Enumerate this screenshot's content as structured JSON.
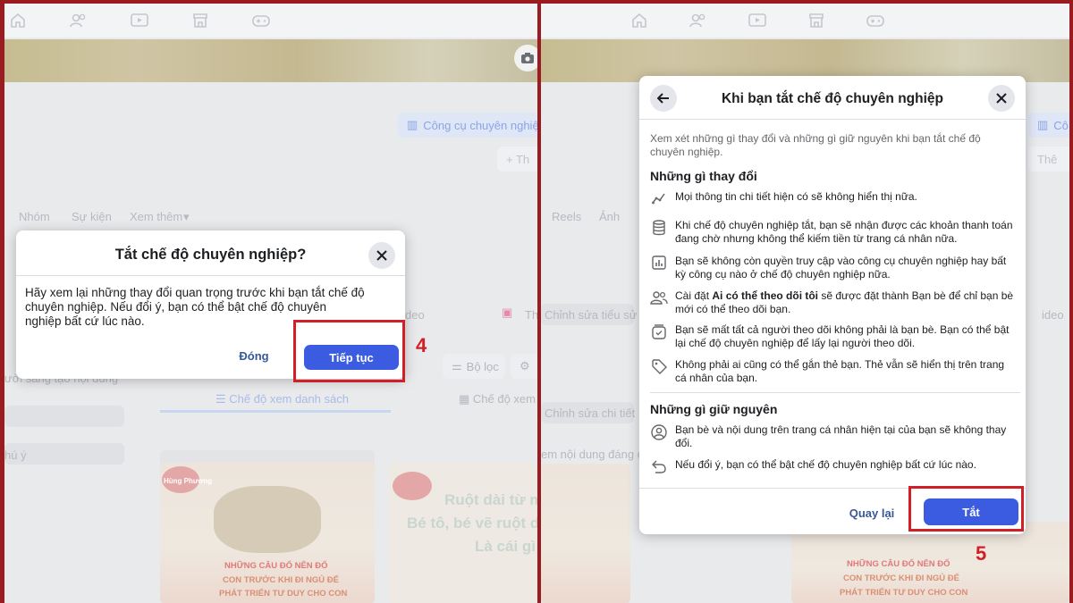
{
  "left": {
    "background": {
      "tool_pill": "Công cụ chuyên nghiệp",
      "tabs": [
        "Nhóm",
        "Sự kiện",
        "Xem thêm"
      ],
      "video_label": "deo",
      "reels_partial": "Th",
      "creator_text": "ười sáng tạo nội dung",
      "filter_label": "Bộ lọc",
      "list_view": "Chế độ xem danh sách",
      "notice_partial": "hú ý",
      "poster_brand": "Hùng Phương",
      "poster_line1": "NHỮNG CÂU ĐỐ NÊN ĐỐ",
      "poster_line2": "CON TRƯỚC KHI ĐI NGỦ ĐỂ",
      "poster_line3": "PHÁT TRIỂN TƯ DUY CHO CON",
      "poster2_line1": "Ruột dài từ mũi c",
      "poster2_line2": "Bé tô, bé vẽ ruột dà",
      "poster2_line3": "Là cái gì"
    },
    "dialog": {
      "title": "Tắt chế độ chuyên nghiệp?",
      "body": "Hãy xem lại những thay đổi quan trọng trước khi bạn tắt chế độ chuyên nghiệp. Nếu đổi ý, bạn có thể bật chế độ chuyên nghiệp bất cứ lúc nào.",
      "close_label": "Đóng",
      "continue_label": "Tiếp tục"
    },
    "step": "4"
  },
  "right": {
    "background": {
      "tool_pill": "Cô",
      "add_pill": "Thê",
      "tabs": [
        "Reels",
        "Ảnh"
      ],
      "edit_bio": "Chỉnh sửa tiểu sử",
      "edit_details": "Chỉnh sửa chi tiết",
      "content_text": "em nội dung đáng ch",
      "video_label": "ideo"
    },
    "dialog": {
      "title": "Khi bạn tắt chế độ chuyên nghiệp",
      "intro": "Xem xét những gì thay đổi và những gì giữ nguyên khi bạn tắt chế độ chuyên nghiệp.",
      "changes_title": "Những gì thay đổi",
      "changes": [
        {
          "icon": "insights-icon",
          "text": "Mọi thông tin chi tiết hiện có sẽ không hiển thị nữa."
        },
        {
          "icon": "coins-icon",
          "text": "Khi chế độ chuyên nghiệp tắt, bạn sẽ nhận được các khoản thanh toán đang chờ nhưng không thể kiếm tiền từ trang cá nhân nữa."
        },
        {
          "icon": "bar-chart-icon",
          "text": "Bạn sẽ không còn quyền truy cập vào công cụ chuyên nghiệp hay bất kỳ công cụ nào ở chế độ chuyên nghiệp nữa."
        },
        {
          "icon": "people-icon",
          "pre": "Cài đặt ",
          "bold": "Ai có thể theo dõi tôi",
          "text": " sẽ được đặt thành Bạn bè để chỉ bạn bè mới có thể theo dõi bạn."
        },
        {
          "icon": "followers-icon",
          "text": "Bạn sẽ mất tất cả người theo dõi không phải là bạn bè. Bạn có thể bật lại chế độ chuyên nghiệp để lấy lại người theo dõi."
        },
        {
          "icon": "tag-icon",
          "text": "Không phải ai cũng có thể gắn thẻ bạn. Thẻ vẫn sẽ hiển thị trên trang cá nhân của bạn."
        }
      ],
      "same_title": "Những gì giữ nguyên",
      "same": [
        {
          "icon": "profile-icon",
          "text": "Bạn bè và nội dung trên trang cá nhân hiện tại của bạn sẽ không thay đổi."
        },
        {
          "icon": "undo-icon",
          "text": "Nếu đổi ý, bạn có thể bật chế độ chuyên nghiệp bất cứ lúc nào."
        }
      ],
      "back_label": "Quay lại",
      "off_label": "Tắt"
    },
    "step": "5"
  },
  "colors": {
    "frame": "#9b1c20",
    "primary": "#3b5ce0",
    "highlight": "#d21f26"
  }
}
